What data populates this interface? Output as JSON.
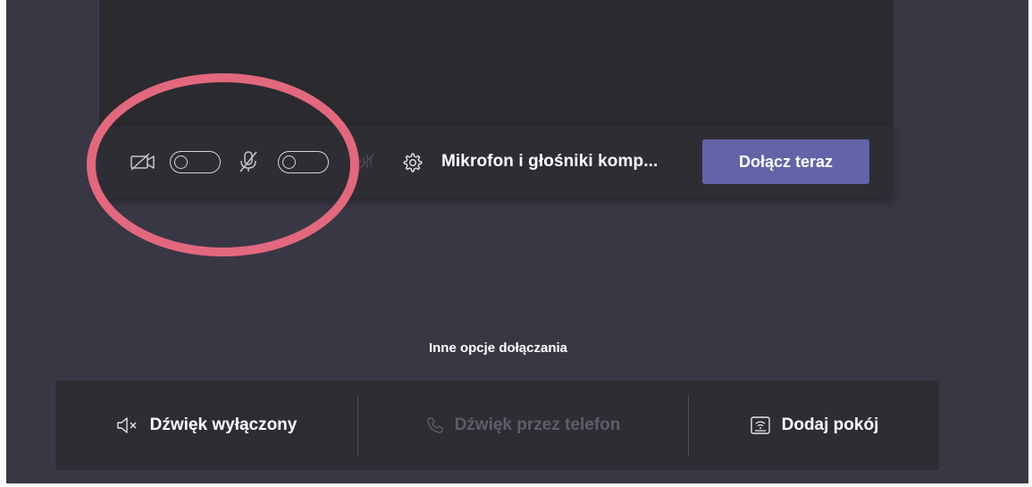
{
  "prejoin": {
    "device_settings_label": "Mikrofon i głośniki komp...",
    "join_button_label": "Dołącz teraz",
    "camera_toggle_state": "off",
    "mic_toggle_state": "off"
  },
  "other_options": {
    "title": "Inne opcje dołączania",
    "items": [
      {
        "label": "Dźwięk wyłączony",
        "icon": "speaker-off-icon",
        "enabled": true
      },
      {
        "label": "Dźwięk przez telefon",
        "icon": "phone-icon",
        "enabled": false
      },
      {
        "label": "Dodaj pokój",
        "icon": "room-device-icon",
        "enabled": true
      }
    ]
  },
  "colors": {
    "background": "#3a3745",
    "panel": "#2e2d33",
    "accent": "#6264a7",
    "annotation": "#e2687e",
    "disabled_text": "#5f5d69"
  }
}
